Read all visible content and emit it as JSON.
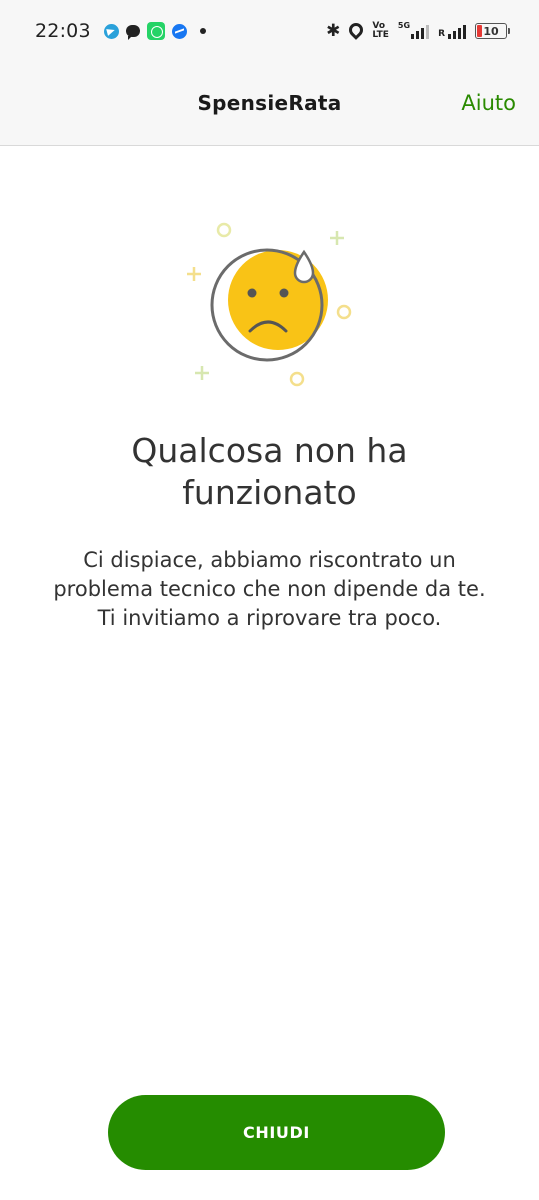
{
  "status_bar": {
    "time": "22:03",
    "notification_icons": [
      "telegram-icon",
      "chat-bubble-icon",
      "whatsapp-icon",
      "messenger-icon",
      "more-dot-icon"
    ],
    "system_icons": [
      "bluetooth-icon",
      "location-icon",
      "volte-icon",
      "5g-signal-icon",
      "roaming-signal-icon",
      "battery-icon"
    ],
    "volte_label_top": "Vo",
    "volte_label_bottom": "LTE",
    "network_label": "5G",
    "roaming_label": "R",
    "battery_level": "10",
    "battery_color": "#e53935"
  },
  "app_bar": {
    "title": "SpensieRata",
    "help_label": "Aiuto",
    "accent_color": "#2a8a00"
  },
  "error": {
    "illustration": "sad-sweating-face-icon",
    "title": "Qualcosa non ha funzionato",
    "message": "Ci dispiace, abbiamo riscontrato un problema tecnico che non dipende da te. Ti invitiamo a riprovare tra poco."
  },
  "footer": {
    "close_label": "CHIUDI",
    "button_color": "#258c00"
  }
}
